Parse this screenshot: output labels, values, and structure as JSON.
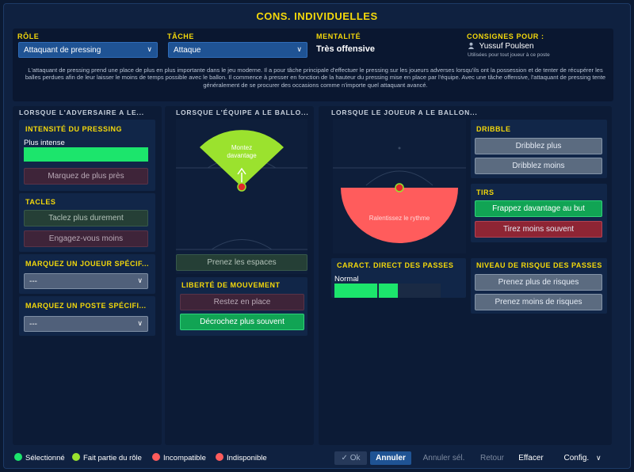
{
  "title": "CONS. INDIVIDUELLES",
  "top": {
    "role_label": "RÔLE",
    "role_value": "Attaquant de pressing",
    "tache_label": "TÂCHE",
    "tache_value": "Attaque",
    "mentalite_label": "MENTALITÉ",
    "mentalite_value": "Très offensive",
    "consignes_label": "CONSIGNES POUR :",
    "player_name": "Yussuf Poulsen",
    "player_sub": "Utilisées pour tout joueur à ce poste",
    "description": "L'attaquant de pressing prend une place de plus en plus importante dans le jeu moderne. Il a pour tâche principale d'effectuer le pressing sur les joueurs adverses lorsqu'ils ont la possession et de tenter de récupérer les balles perdues afin de leur laisser le moins de temps possible avec le ballon. Il commence à presser en fonction de la hauteur du pressing mise en place par l'équipe. Avec une tâche offensive, l'attaquant de pressing tente généralement de se procurer des occasions comme n'importe quel attaquant avancé."
  },
  "col1": {
    "header": "LORSQUE L'ADVERSAIRE A LE...",
    "pressing_title": "INTENSITÉ DU PRESSING",
    "pressing_level": "Plus intense",
    "marquez_btn": "Marquez de plus près",
    "tacles_title": "TACLES",
    "tacles_btn1": "Taclez plus durement",
    "tacles_btn2": "Engagez-vous moins",
    "joueur_title": "MARQUEZ UN JOUEUR SPÉCIF...",
    "joueur_value": "---",
    "poste_title": "MARQUEZ UN POSTE SPÉCIFI...",
    "poste_value": "---"
  },
  "col2": {
    "header": "LORSQUE L'ÉQUIPE A LE BALLO...",
    "pitch_label_1": "Montez",
    "pitch_label_2": "davantage",
    "espaces_btn": "Prenez les espaces",
    "liberte_title": "LIBERTÉ DE MOUVEMENT",
    "liberte_btn1": "Restez en place",
    "liberte_btn2": "Décrochez plus souvent"
  },
  "col3": {
    "header": "LORSQUE LE JOUEUR A LE BALLON...",
    "pitch_label": "Ralentissez le rythme",
    "passes_title": "CARACT. DIRECT DES PASSES",
    "passes_level": "Normal",
    "passes_fraction": 0.6,
    "dribble_title": "DRIBBLE",
    "dribble_btn1": "Dribblez plus",
    "dribble_btn2": "Dribblez moins",
    "tirs_title": "TIRS",
    "tirs_btn1": "Frappez davantage au but",
    "tirs_btn2": "Tirez moins souvent",
    "risque_title": "NIVEAU DE RISQUE DES PASSES",
    "risque_btn1": "Prenez plus de risques",
    "risque_btn2": "Prenez moins de risques"
  },
  "legend": {
    "selected": "Sélectionné",
    "in_role": "Fait partie du rôle",
    "incompatible": "Incompatible",
    "unavailable": "Indisponible"
  },
  "footer": {
    "ok": "Ok",
    "annuler": "Annuler",
    "annuler_sel": "Annuler sél.",
    "retour": "Retour",
    "effacer": "Effacer",
    "config": "Config."
  },
  "colors": {
    "accent_yellow": "#f5d90a",
    "selected_green": "#1ce56c",
    "role_green": "#9be22e",
    "incompatible_red": "#ff5c5c",
    "unavailable_red": "#ff5c5c"
  }
}
